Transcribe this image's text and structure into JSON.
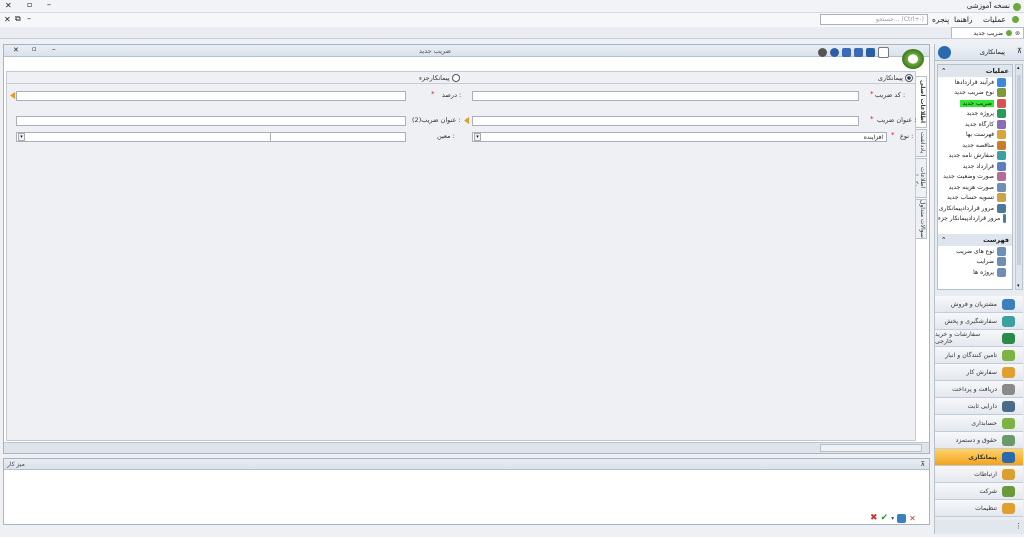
{
  "app": {
    "title": "نسخه آموزشی"
  },
  "menu": {
    "operations": "عملیات",
    "help": "راهنما",
    "window": "پنجره",
    "search_placeholder": "جستجو... (Ctrl+-)"
  },
  "tabs": [
    {
      "label": "ضریب جدید"
    }
  ],
  "document": {
    "title": "ضریب جدید",
    "radio_contracting": "پیمانکاری",
    "radio_contracting_part": "پیمانکارجزء",
    "coef_code_label": "کد ضریب :",
    "percent_label": "درصد :",
    "coef_title_label": "عنوان ضریب :",
    "coef_title2_label": "عنوان ضریب(2) :",
    "type_label": "نوع :",
    "type_value": "افزاینده",
    "moein_label": "معین :",
    "required_mark": "*",
    "side_tabs": [
      "اطلاعات اصلی",
      "یادداشت",
      "اطلاعات تکمیلی",
      "سوالات متداول"
    ]
  },
  "workspace": {
    "title": "میز کار"
  },
  "right_panel": {
    "header": "پیمانکاری",
    "operations_title": "عملیات",
    "operations": [
      {
        "label": "فرآیند قراردادها",
        "color": "#3b8ad9"
      },
      {
        "label": "نوع ضریب جدید",
        "color": "#7c9a3a"
      },
      {
        "label": "ضریب جدید",
        "color": "#d9534f",
        "active": true
      },
      {
        "label": "پروژه جدید",
        "color": "#2a9a5a"
      },
      {
        "label": "کارگاه جدید",
        "color": "#8a6bb5"
      },
      {
        "label": "فهرست بها",
        "color": "#d9a43a"
      },
      {
        "label": "مناقصه جدید",
        "color": "#c77d2a"
      },
      {
        "label": "سفارش نامه جدید",
        "color": "#3aa0a0"
      },
      {
        "label": "قرارداد جدید",
        "color": "#5b7fbf"
      },
      {
        "label": "صورت وضعیت جدید",
        "color": "#b56b9a"
      },
      {
        "label": "صورت هزینه جدید",
        "color": "#6b8fb5"
      },
      {
        "label": "تسویه حساب جدید",
        "color": "#c9a44a"
      },
      {
        "label": "مرور قراردادپیمانکاری",
        "color": "#4a7a9a"
      },
      {
        "label": "مرور قراردادپیمانکار جزء",
        "color": "#4a7a9a"
      }
    ],
    "lists_title": "فهرست",
    "lists": [
      {
        "label": "نوع های ضریب"
      },
      {
        "label": "ضرایب"
      },
      {
        "label": "پروژه ها"
      }
    ],
    "nav": [
      {
        "label": "مشتریان و فروش",
        "color": "#3a7fc0"
      },
      {
        "label": "سفارشگیری و پخش",
        "color": "#3aa0a0"
      },
      {
        "label": "سفارشات و خرید خارجی",
        "color": "#2a8a4a"
      },
      {
        "label": "تامین کنندگان و انبار",
        "color": "#7cb342"
      },
      {
        "label": "سفارش کار",
        "color": "#e0a030"
      },
      {
        "label": "دریافت و پرداخت",
        "color": "#8a8a8a"
      },
      {
        "label": "دارایی ثابت",
        "color": "#4a6a8a"
      },
      {
        "label": "حسابداری",
        "color": "#7cb342"
      },
      {
        "label": "حقوق و دستمزد",
        "color": "#6a9a6a"
      },
      {
        "label": "پیمانکاری",
        "color": "#2a6ab0",
        "active": true
      },
      {
        "label": "ارتباطات",
        "color": "#d9a030"
      },
      {
        "label": "شرکت",
        "color": "#6a9a3a"
      },
      {
        "label": "تنظیمات",
        "color": "#e0a030"
      }
    ]
  }
}
